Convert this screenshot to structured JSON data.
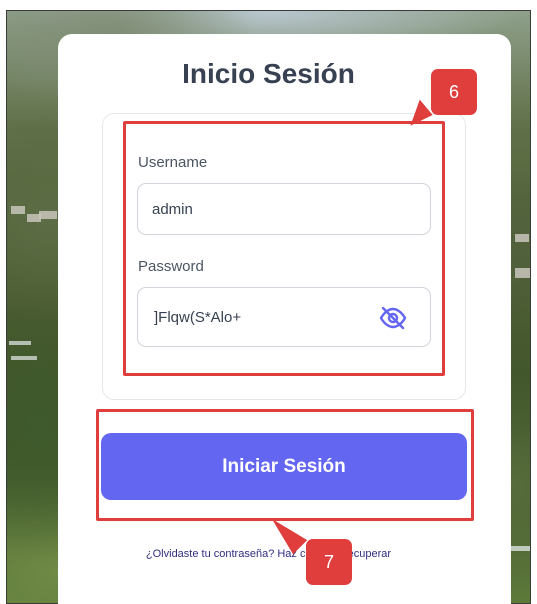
{
  "login": {
    "title": "Inicio Sesión",
    "username_label": "Username",
    "username_value": "admin",
    "password_label": "Password",
    "password_value": "]Flqw(S*Alo+",
    "submit_label": "Iniciar Sesión",
    "forgot_link": "¿Olvidaste tu contraseña? Haz clic para recuperar"
  },
  "annotations": {
    "badge_fields": "6",
    "badge_submit": "7"
  },
  "icons": {
    "password_toggle": "eye-off-icon"
  },
  "colors": {
    "primary": "#6366f1",
    "annotation": "#e03d3d",
    "link": "#312e81"
  }
}
